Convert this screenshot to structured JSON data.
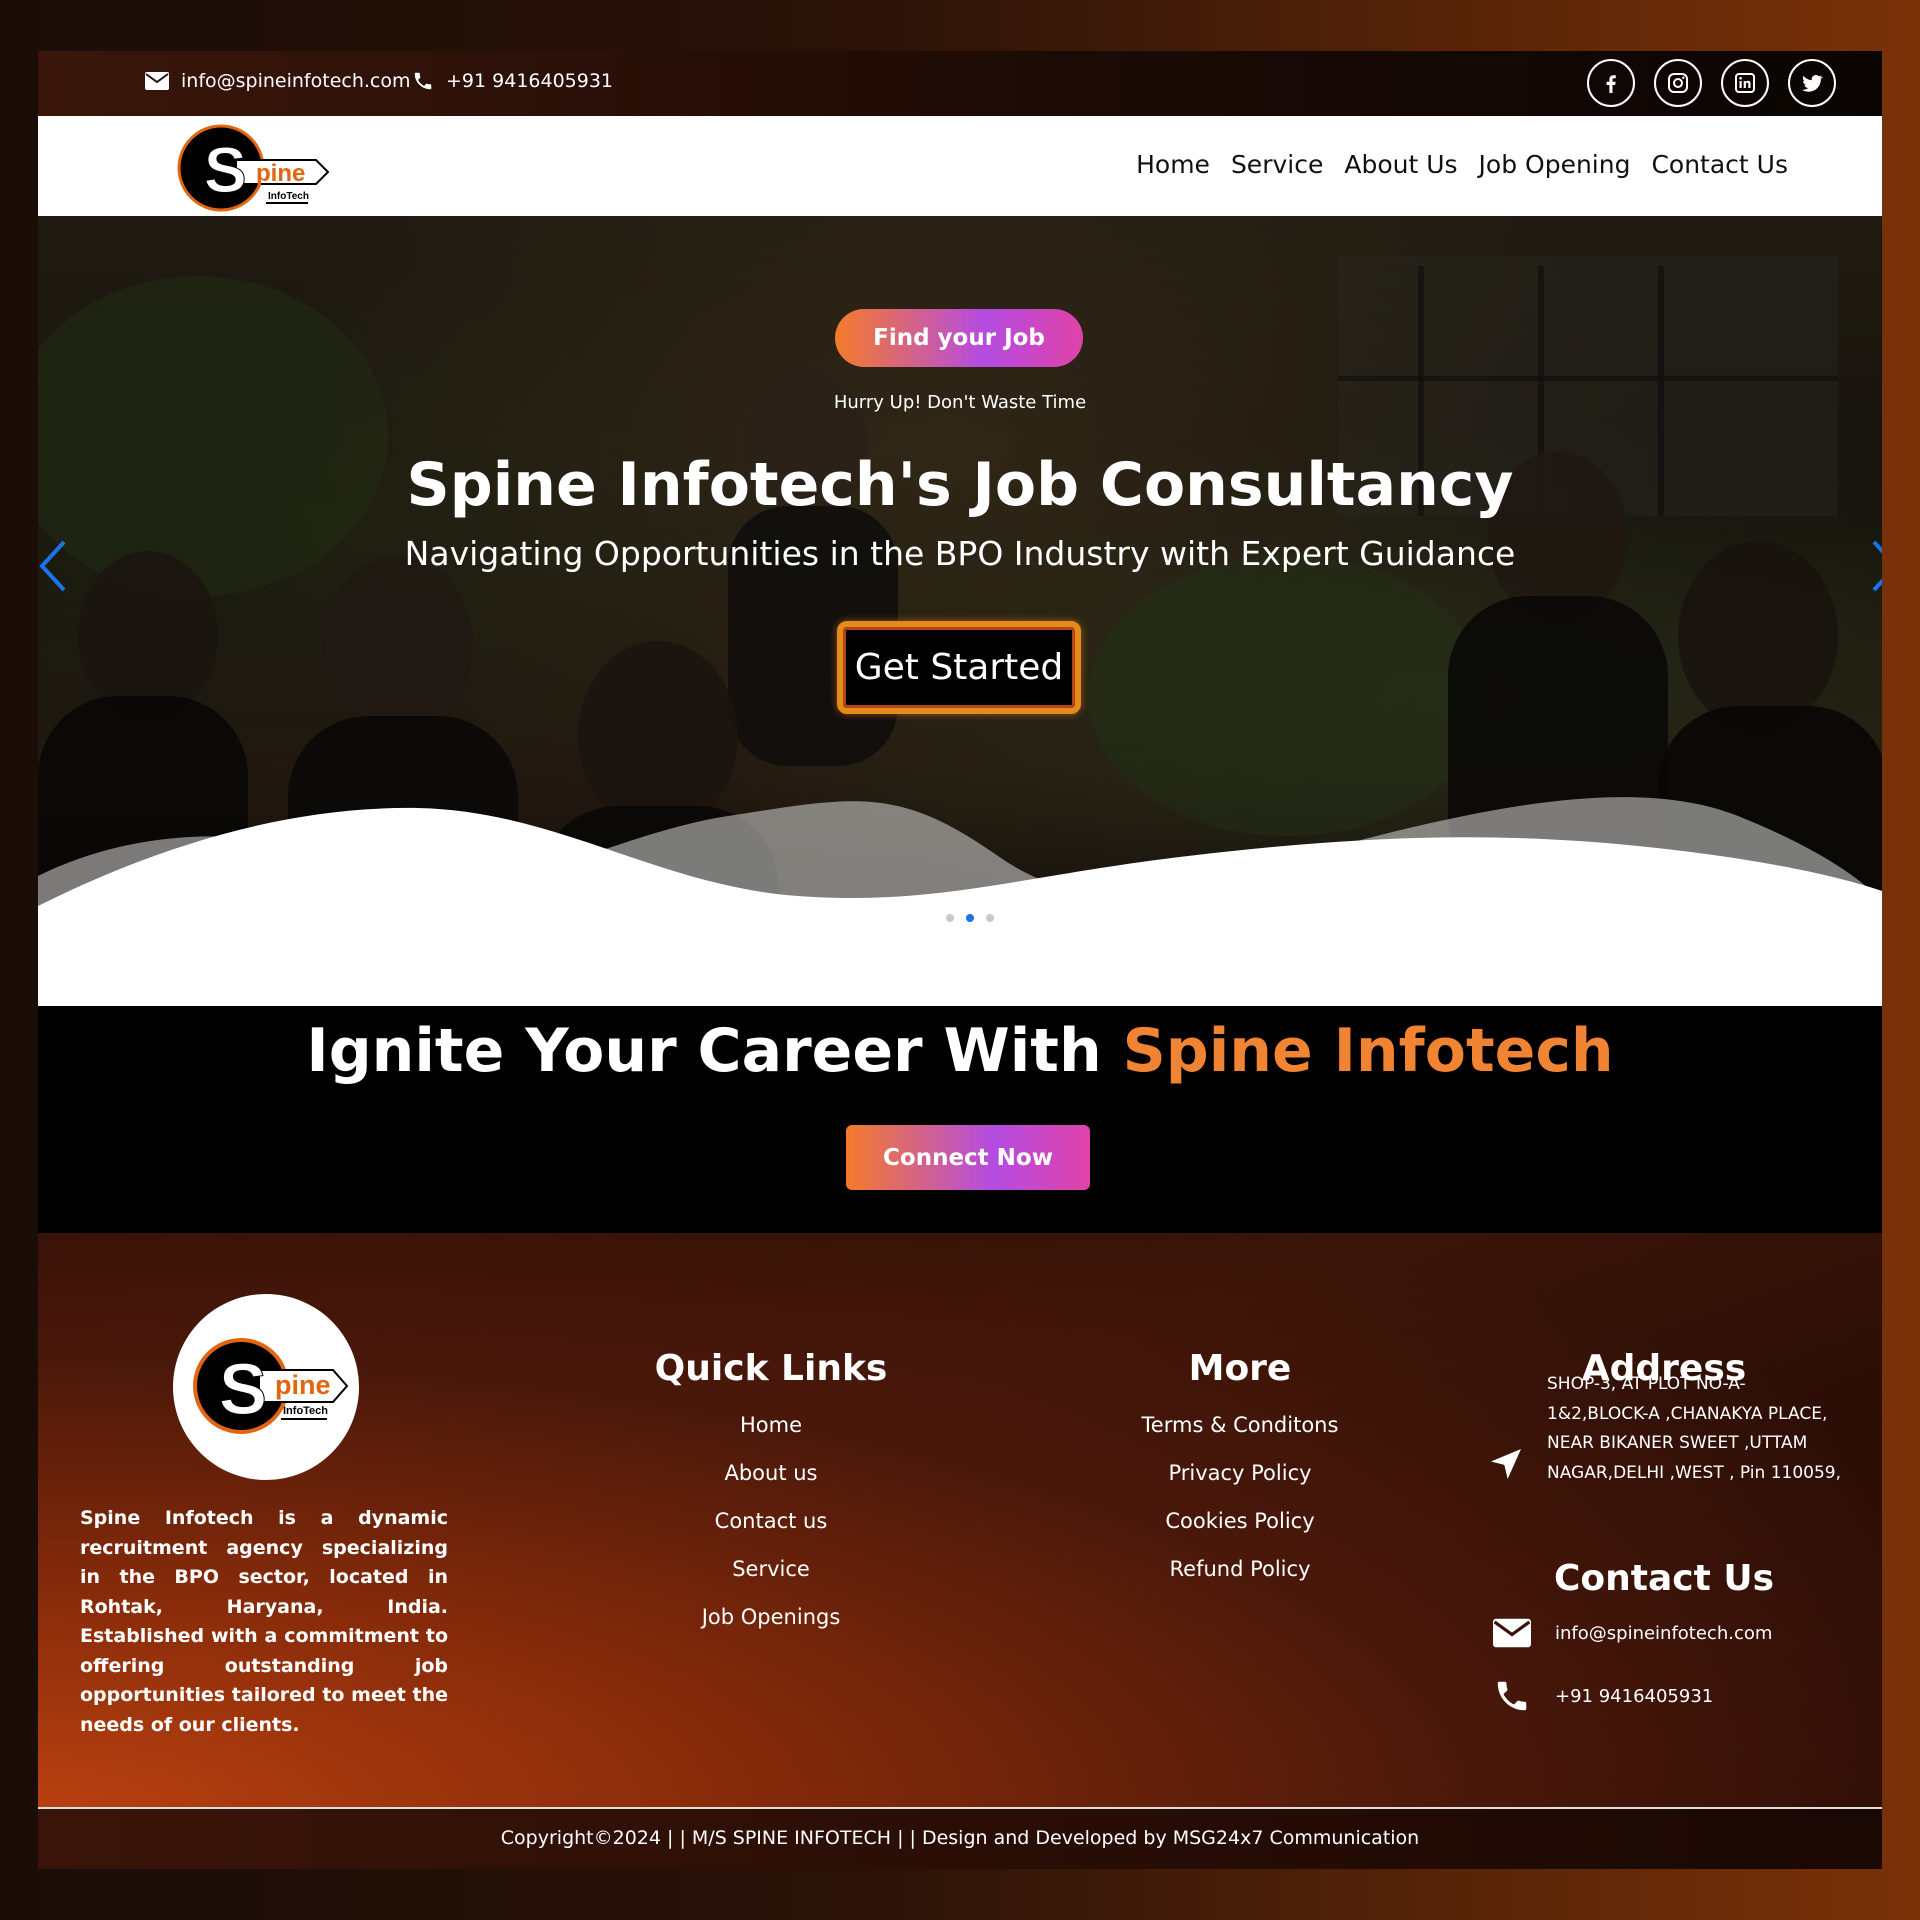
{
  "topbar": {
    "email": "info@spineinfotech.com",
    "phone": "+91 9416405931",
    "socials": [
      "facebook-icon",
      "instagram-icon",
      "linkedin-icon",
      "twitter-icon"
    ]
  },
  "brand": {
    "logo_main": "pine",
    "logo_s": "S",
    "logo_sub": "InfoTech"
  },
  "nav": {
    "items": [
      "Home",
      "Service",
      "About Us",
      "Job Opening",
      "Contact Us"
    ]
  },
  "hero": {
    "badge_label": "Find your Job",
    "tagline": "Hurry Up! Don't Waste Time",
    "title": "Spine Infotech's Job Consultancy",
    "subtitle": "Navigating Opportunities in the BPO Industry with Expert Guidance",
    "cta_label": "Get Started",
    "slides_total": 3,
    "active_slide": 2
  },
  "cta": {
    "title_prefix": "Ignite Your Career With ",
    "title_accent": "Spine Infotech",
    "button_label": "Connect Now"
  },
  "footer": {
    "about": "Spine Infotech is a dynamic recruitment agency specializing in the BPO sector, located in Rohtak, Haryana, India. Established with a commitment to offering outstanding job opportunities tailored to meet the needs of our clients.",
    "quick_links": {
      "title": "Quick Links",
      "items": [
        "Home",
        "About us",
        "Contact us",
        "Service",
        "Job Openings"
      ]
    },
    "more": {
      "title": "More",
      "items": [
        "Terms & Conditons",
        "Privacy Policy",
        "Cookies Policy",
        "Refund Policy"
      ]
    },
    "address": {
      "title": "Address",
      "text": "SHOP-3, AT PLOT NO-A-1&2,BLOCK-A ,CHANAKYA PLACE, NEAR BIKANER SWEET ,UTTAM NAGAR,DELHI ,WEST , Pin 110059,"
    },
    "contact": {
      "title": "Contact Us",
      "email": "info@spineinfotech.com",
      "phone": "+91 9416405931"
    },
    "copyright": "Copyright©2024 | | M/S SPINE INFOTECH | | Design and Developed by MSG24x7 Communication"
  },
  "colors": {
    "accent_orange": "#f08433",
    "gradient_start": "#f47b2a",
    "gradient_mid": "#b44ce2",
    "gradient_end": "#e043a8",
    "slider_active": "#1a73e8"
  }
}
